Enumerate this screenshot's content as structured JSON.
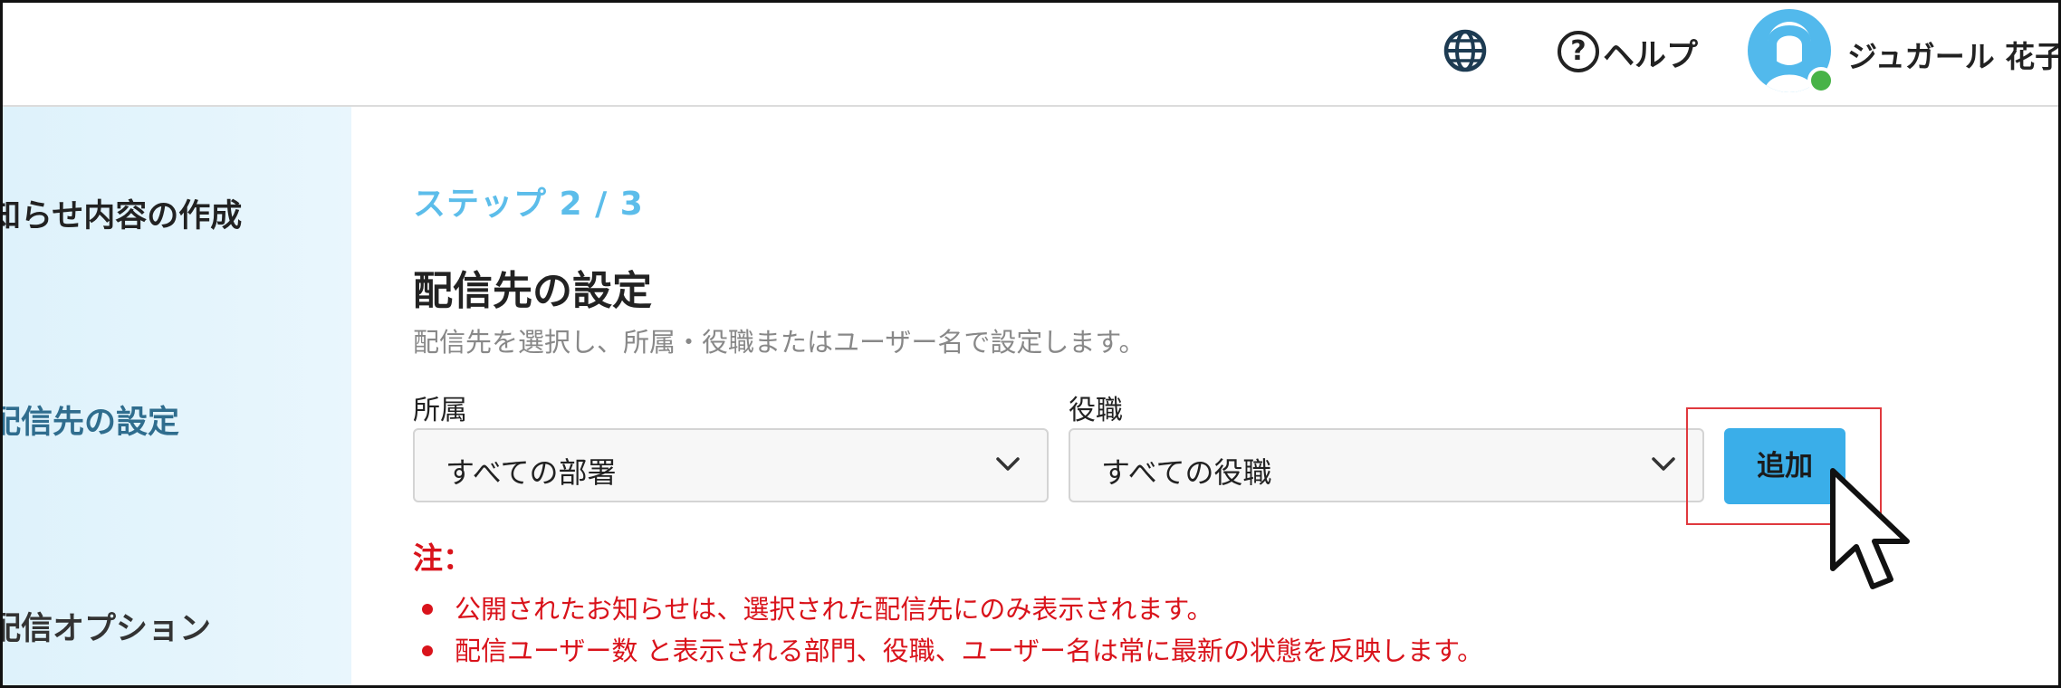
{
  "header": {
    "globe_icon": "globe-icon",
    "help_label": "ヘルプ",
    "help_icon_glyph": "?",
    "user_name": "ジュガール 花子",
    "user_status": "online"
  },
  "sidebar": {
    "items": [
      {
        "label": "知らせ内容の作成",
        "state": "default"
      },
      {
        "label": "配信先の設定",
        "state": "active"
      },
      {
        "label": "配信オプション",
        "state": "default"
      }
    ]
  },
  "main": {
    "step": "ステップ 2 / 3",
    "title": "配信先の設定",
    "description": "配信先を選択し、所属・役職またはユーザー名で設定します。",
    "affiliation": {
      "label": "所属",
      "value": "すべての部署"
    },
    "position": {
      "label": "役職",
      "value": "すべての役職"
    },
    "add_button": "追加",
    "note": {
      "title": "注：",
      "items": [
        "公開されたお知らせは、選択された配信先にのみ表示されます。",
        "配信ユーザー数 と表示される部門、役職、ユーザー名は常に最新の状態を反映します。"
      ]
    }
  },
  "colors": {
    "accent": "#3aaee9",
    "step": "#5cbdea",
    "active_nav": "#2f6d8e",
    "warning": "#d9131b",
    "highlight": "#e0393e"
  }
}
